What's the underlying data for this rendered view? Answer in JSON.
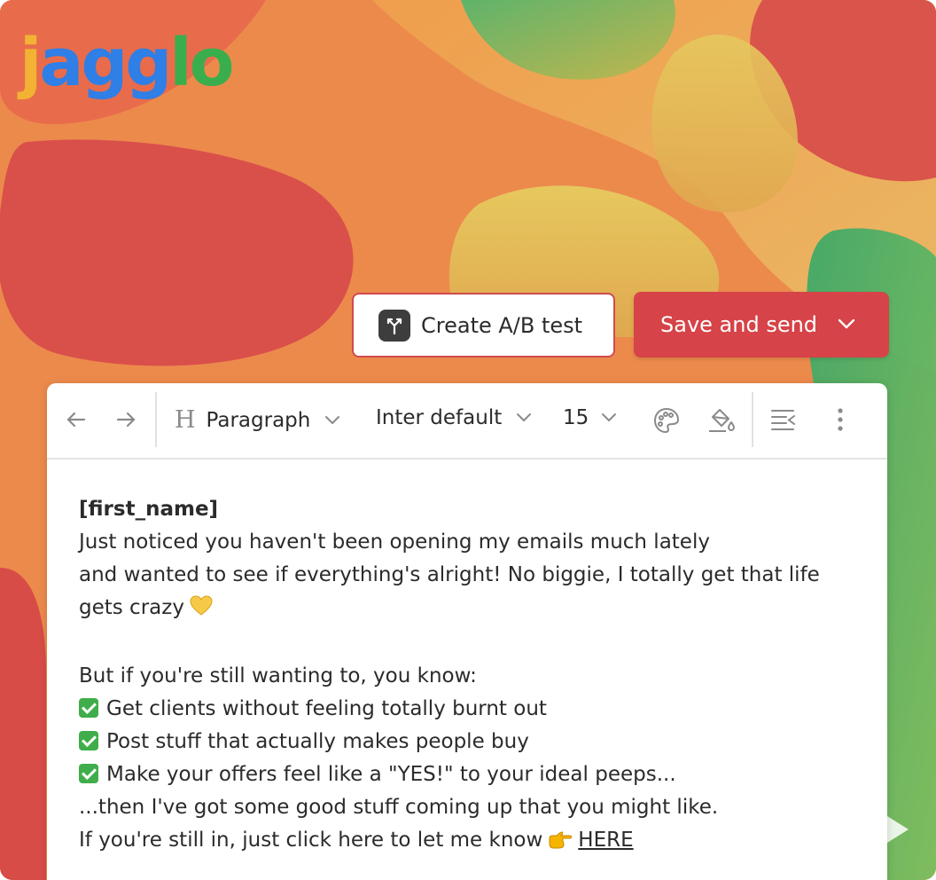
{
  "brand": {
    "logo_letters": [
      "j",
      "a",
      "g",
      "g",
      "l",
      "o"
    ],
    "logo_colors": [
      "#f2b233",
      "#2f7fe6",
      "#2f7fe6",
      "#2f7fe6",
      "#3aae4d",
      "#3aae4d"
    ]
  },
  "actions": {
    "ab_test_label": "Create A/B test",
    "save_send_label": "Save and send"
  },
  "toolbar": {
    "block_type": "Paragraph",
    "font_family": "Inter default",
    "font_size": "15",
    "icons": [
      "undo-icon",
      "redo-icon",
      "heading-icon",
      "palette-icon",
      "paint-bucket-icon",
      "text-direction-icon",
      "more-vertical-icon"
    ]
  },
  "email": {
    "greeting": "[first_name]",
    "line1": "Just noticed you haven't been opening my emails much lately",
    "line2": "and wanted to see if everything's alright! No biggie, I totally get that life",
    "line3": "gets crazy",
    "line4": "But if you're still wanting to, you know:",
    "bullets": [
      "Get clients without feeling totally burnt out",
      "Post stuff that actually makes people buy",
      "Make your offers feel like a \"YES!\" to your ideal peeps..."
    ],
    "line5": "...then I've got some good stuff coming up that you might like.",
    "line6": "If you're still in, just click here to let me know",
    "link_text": "HERE"
  },
  "colors": {
    "accent": "#d64348",
    "text": "#2b2b2b"
  }
}
